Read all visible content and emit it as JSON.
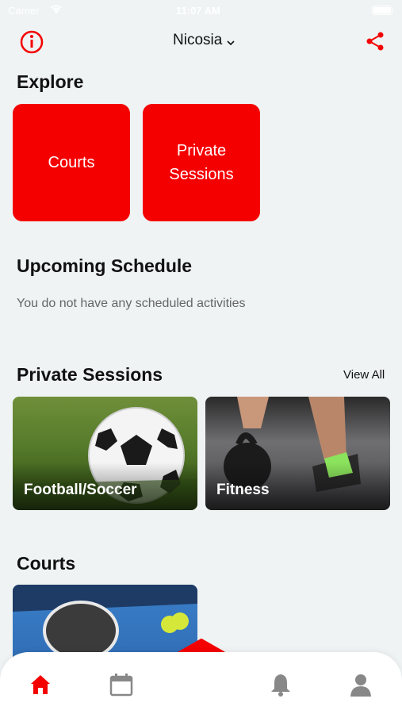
{
  "status_bar": {
    "carrier": "Carrier",
    "time": "11:07 AM"
  },
  "header": {
    "city": "Nicosia"
  },
  "explore": {
    "title": "Explore",
    "tiles": [
      {
        "label": "Courts"
      },
      {
        "label": "Private Sessions"
      }
    ]
  },
  "schedule": {
    "title": "Upcoming Schedule",
    "empty_message": "You do not have any scheduled activities"
  },
  "private_sessions": {
    "title": "Private Sessions",
    "view_all": "View All",
    "cards": [
      {
        "label": "Football/Soccer"
      },
      {
        "label": "Fitness"
      }
    ]
  },
  "courts": {
    "title": "Courts"
  },
  "colors": {
    "accent": "#f50000",
    "background": "#eff3f3"
  },
  "tab_bar": {
    "tabs": [
      {
        "icon": "home-icon",
        "active": true
      },
      {
        "icon": "calendar-icon",
        "active": false
      },
      {
        "icon": "plus-icon",
        "active": false
      },
      {
        "icon": "bell-icon",
        "active": false
      },
      {
        "icon": "profile-icon",
        "active": false
      }
    ]
  }
}
